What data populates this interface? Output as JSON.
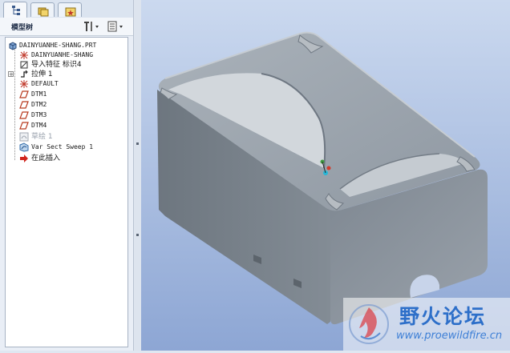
{
  "panel": {
    "title": "模型树"
  },
  "tree": [
    {
      "label": "DAINYUANHE-SHANG.PRT",
      "icon": "part-icon",
      "state": "normal"
    },
    {
      "label": "DAINYUANHE-SHANG",
      "icon": "coordinate-system-icon",
      "state": "normal"
    },
    {
      "label": "导入特征 标识4",
      "icon": "import-feature-icon",
      "state": "normal"
    },
    {
      "label": "拉伸 1",
      "icon": "extrude-icon",
      "state": "collapsed"
    },
    {
      "label": "DEFAULT",
      "icon": "coordinate-system-icon",
      "state": "normal"
    },
    {
      "label": "DTM1",
      "icon": "datum-plane-icon",
      "state": "normal"
    },
    {
      "label": "DTM2",
      "icon": "datum-plane-icon",
      "state": "normal"
    },
    {
      "label": "DTM3",
      "icon": "datum-plane-icon",
      "state": "normal"
    },
    {
      "label": "DTM4",
      "icon": "datum-plane-icon",
      "state": "normal"
    },
    {
      "label": "草绘 1",
      "icon": "sketch-icon",
      "state": "hidden"
    },
    {
      "label": "Var Sect Sweep 1",
      "icon": "sweep-icon",
      "state": "normal"
    },
    {
      "label": "在此插入",
      "icon": "insert-here-arrow-icon",
      "state": "normal"
    }
  ],
  "watermark": {
    "title": "野火论坛",
    "url": "www.proewildfire.cn"
  },
  "colors": {
    "accent": "#2d6fc9",
    "viewport_top": "#c9d7ee",
    "viewport_bottom": "#8ea6d4",
    "part_gray": "#8a929c"
  }
}
